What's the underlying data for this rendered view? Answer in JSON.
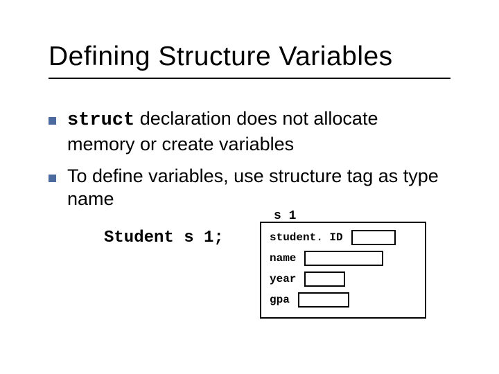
{
  "title": "Defining Structure Variables",
  "bullets": [
    {
      "code": "struct",
      "text_rest": " declaration does not allocate memory or create variables"
    },
    {
      "text": "To define variables, use structure tag as type name"
    }
  ],
  "struct_label": "s 1",
  "code_line": "Student s 1;",
  "fields": {
    "studentID": "student. ID",
    "name": "name",
    "year": "year",
    "gpa": "gpa"
  }
}
